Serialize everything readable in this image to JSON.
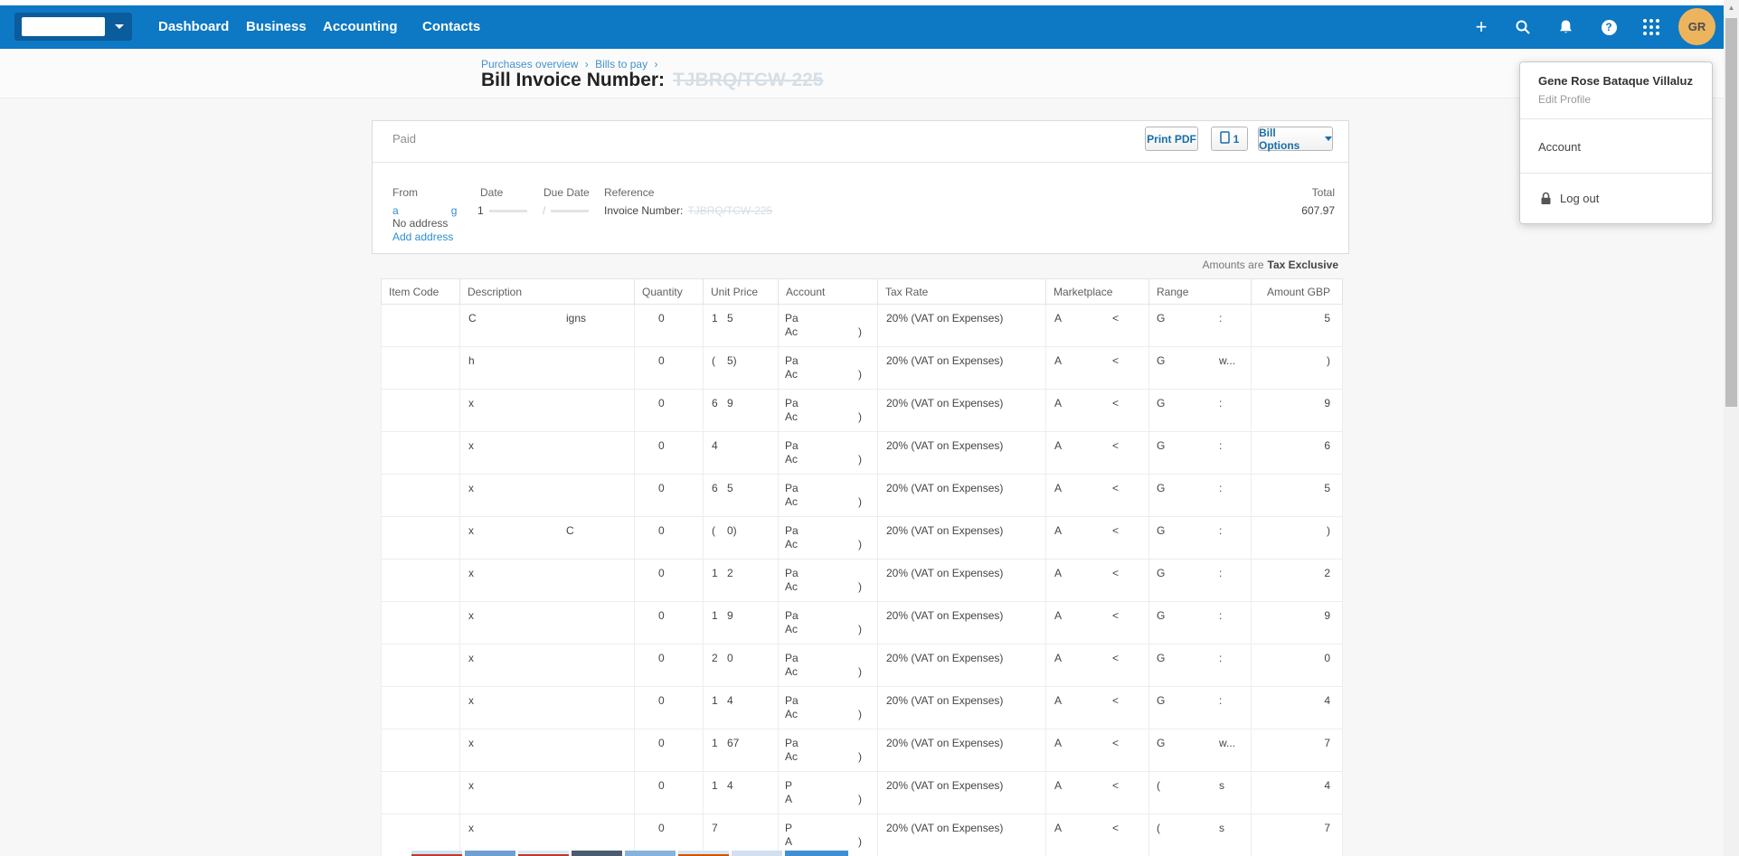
{
  "nav": {
    "items": [
      {
        "label": "Dashboard"
      },
      {
        "label": "Business"
      },
      {
        "label": "Accounting"
      },
      {
        "label": "Contacts"
      }
    ],
    "add_glyph": "+",
    "help_glyph": "?",
    "avatar_initials": "GR"
  },
  "breadcrumb": {
    "item1": "Purchases overview",
    "item2": "Bills to pay",
    "separator": "›"
  },
  "page_title": {
    "prefix": "Bill Invoice Number:",
    "redacted_number": "TJBRQ/TCW-225"
  },
  "profile_menu": {
    "name": "Gene Rose Bataque Villaluz",
    "edit_profile": "Edit Profile",
    "account": "Account",
    "logout": "Log out"
  },
  "bill_card": {
    "status": "Paid",
    "print_pdf_label": "Print PDF",
    "doc_count": "1",
    "bill_options_label": "Bill Options",
    "from_label": "From",
    "date_label": "Date",
    "due_date_label": "Due Date",
    "reference_label": "Reference",
    "total_label": "Total",
    "from_fragment_1": "a",
    "from_fragment_2": "g",
    "date_fragment": "1",
    "due_date_fragment": "/",
    "reference_prefix": "Invoice Number:",
    "reference_redacted": "TJBRQ/TCW-225",
    "no_address": "No address",
    "add_address": "Add address",
    "total_value": "607.97",
    "tax_note_prefix": "Amounts are",
    "tax_note_value": "Tax Exclusive"
  },
  "table": {
    "columns": [
      "Item Code",
      "Description",
      "Quantity",
      "Unit Price",
      "Account",
      "Tax Rate",
      "Marketplace",
      "Range",
      "Amount GBP"
    ],
    "rows": [
      {
        "item": "",
        "desc1": "C",
        "desc2": "igns",
        "qty": "0",
        "unit1": "1",
        "unit2": "5",
        "acct1": "Pa",
        "acct2": "Ac",
        "acct3": ")",
        "tax": "20% (VAT on Expenses)",
        "mkt1": "A",
        "mkt2": "<",
        "range1": "G",
        "range2": ":",
        "amount": "5"
      },
      {
        "item": "",
        "desc1": "h",
        "desc2": "",
        "qty": "0",
        "unit1": "(",
        "unit2": "5)",
        "acct1": "Pa",
        "acct2": "Ac",
        "acct3": ")",
        "tax": "20% (VAT on Expenses)",
        "mkt1": "A",
        "mkt2": "<",
        "range1": "G",
        "range2": "w...",
        "amount": ")"
      },
      {
        "item": "",
        "desc1": "x",
        "desc2": "",
        "qty": "0",
        "unit1": "6",
        "unit2": "9",
        "acct1": "Pa",
        "acct2": "Ac",
        "acct3": ")",
        "tax": "20% (VAT on Expenses)",
        "mkt1": "A",
        "mkt2": "<",
        "range1": "G",
        "range2": ":",
        "amount": "9"
      },
      {
        "item": "",
        "desc1": "x",
        "desc2": "",
        "qty": "0",
        "unit1": "4",
        "unit2": "",
        "acct1": "Pa",
        "acct2": "Ac",
        "acct3": ")",
        "tax": "20% (VAT on Expenses)",
        "mkt1": "A",
        "mkt2": "<",
        "range1": "G",
        "range2": ":",
        "amount": "6"
      },
      {
        "item": "",
        "desc1": "x",
        "desc2": "",
        "qty": "0",
        "unit1": "6",
        "unit2": "5",
        "acct1": "Pa",
        "acct2": "Ac",
        "acct3": ")",
        "tax": "20% (VAT on Expenses)",
        "mkt1": "A",
        "mkt2": "<",
        "range1": "G",
        "range2": ":",
        "amount": "5"
      },
      {
        "item": "",
        "desc1": "x",
        "desc2": "C",
        "qty": "0",
        "unit1": "(",
        "unit2": "0)",
        "acct1": "Pa",
        "acct2": "Ac",
        "acct3": ")",
        "tax": "20% (VAT on Expenses)",
        "mkt1": "A",
        "mkt2": "<",
        "range1": "G",
        "range2": ":",
        "amount": ")"
      },
      {
        "item": "",
        "desc1": "x",
        "desc2": "",
        "qty": "0",
        "unit1": "1",
        "unit2": "2",
        "acct1": "Pa",
        "acct2": "Ac",
        "acct3": ")",
        "tax": "20% (VAT on Expenses)",
        "mkt1": "A",
        "mkt2": "<",
        "range1": "G",
        "range2": ":",
        "amount": "2"
      },
      {
        "item": "",
        "desc1": "x",
        "desc2": "",
        "qty": "0",
        "unit1": "1",
        "unit2": "9",
        "acct1": "Pa",
        "acct2": "Ac",
        "acct3": ")",
        "tax": "20% (VAT on Expenses)",
        "mkt1": "A",
        "mkt2": "<",
        "range1": "G",
        "range2": ":",
        "amount": "9"
      },
      {
        "item": "",
        "desc1": "x",
        "desc2": "",
        "qty": "0",
        "unit1": "2",
        "unit2": "0",
        "acct1": "Pa",
        "acct2": "Ac",
        "acct3": ")",
        "tax": "20% (VAT on Expenses)",
        "mkt1": "A",
        "mkt2": "<",
        "range1": "G",
        "range2": ":",
        "amount": "0"
      },
      {
        "item": "",
        "desc1": "x",
        "desc2": "",
        "qty": "0",
        "unit1": "1",
        "unit2": "4",
        "acct1": "Pa",
        "acct2": "Ac",
        "acct3": ")",
        "tax": "20% (VAT on Expenses)",
        "mkt1": "A",
        "mkt2": "<",
        "range1": "G",
        "range2": ":",
        "amount": "4"
      },
      {
        "item": "",
        "desc1": "x",
        "desc2": "",
        "qty": "0",
        "unit1": "1",
        "unit2": "67",
        "acct1": "Pa",
        "acct2": "Ac",
        "acct3": ")",
        "tax": "20% (VAT on Expenses)",
        "mkt1": "A",
        "mkt2": "<",
        "range1": "G",
        "range2": "w...",
        "amount": "7"
      },
      {
        "item": "",
        "desc1": "x",
        "desc2": "",
        "qty": "0",
        "unit1": "1",
        "unit2": "4",
        "acct1": "P",
        "acct2": "A",
        "acct3": ")",
        "tax": "20% (VAT on Expenses)",
        "mkt1": "A",
        "mkt2": "<",
        "range1": "(",
        "range2": "s",
        "amount": "4"
      },
      {
        "item": "",
        "desc1": "x",
        "desc2": "",
        "qty": "0",
        "unit1": "7",
        "unit2": "",
        "acct1": "P",
        "acct2": "A",
        "acct3": ")",
        "tax": "20% (VAT on Expenses)",
        "mkt1": "A",
        "mkt2": "<",
        "range1": "(",
        "range2": "s",
        "amount": "7"
      }
    ]
  }
}
